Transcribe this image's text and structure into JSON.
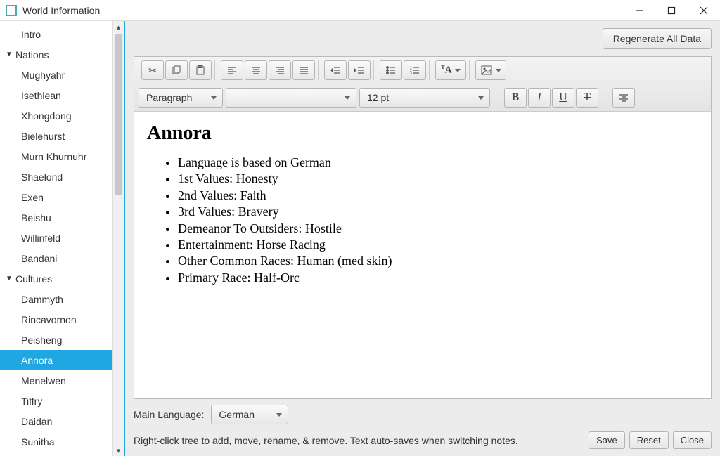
{
  "window": {
    "title": "World Information"
  },
  "topactions": {
    "regenerate": "Regenerate All Data"
  },
  "tree": {
    "items": [
      {
        "label": "Intro",
        "level": 2,
        "expandable": false
      },
      {
        "label": "Nations",
        "level": 1,
        "expandable": true,
        "expanded": true
      },
      {
        "label": "Mughyahr",
        "level": 2
      },
      {
        "label": "Isethlean",
        "level": 2
      },
      {
        "label": "Xhongdong",
        "level": 2
      },
      {
        "label": "Bielehurst",
        "level": 2
      },
      {
        "label": "Murn Khurnuhr",
        "level": 2
      },
      {
        "label": "Shaelond",
        "level": 2
      },
      {
        "label": "Exen",
        "level": 2
      },
      {
        "label": "Beishu",
        "level": 2
      },
      {
        "label": "Willinfeld",
        "level": 2
      },
      {
        "label": "Bandani",
        "level": 2
      },
      {
        "label": "Cultures",
        "level": 1,
        "expandable": true,
        "expanded": true
      },
      {
        "label": "Dammyth",
        "level": 2
      },
      {
        "label": "Rincavornon",
        "level": 2
      },
      {
        "label": "Peisheng",
        "level": 2
      },
      {
        "label": "Annora",
        "level": 2,
        "selected": true
      },
      {
        "label": "Menelwen",
        "level": 2
      },
      {
        "label": "Tiffry",
        "level": 2
      },
      {
        "label": "Daidan",
        "level": 2
      },
      {
        "label": "Sunitha",
        "level": 2
      }
    ]
  },
  "toolbar2": {
    "style_combo": "Paragraph",
    "font_combo": "",
    "size_combo": "12 pt"
  },
  "document": {
    "title": "Annora",
    "bullets": [
      "Language is based on German",
      "1st Values: Honesty",
      "2nd Values: Faith",
      "3rd Values: Bravery",
      "Demeanor To Outsiders: Hostile",
      "Entertainment: Horse Racing",
      "Other Common Races: Human (med skin)",
      "Primary Race: Half-Orc"
    ]
  },
  "footer": {
    "lang_label": "Main Language:",
    "lang_value": "German",
    "hint": "Right-click tree to add, move, rename, & remove. Text auto-saves when switching notes.",
    "save": "Save",
    "reset": "Reset",
    "close": "Close"
  }
}
